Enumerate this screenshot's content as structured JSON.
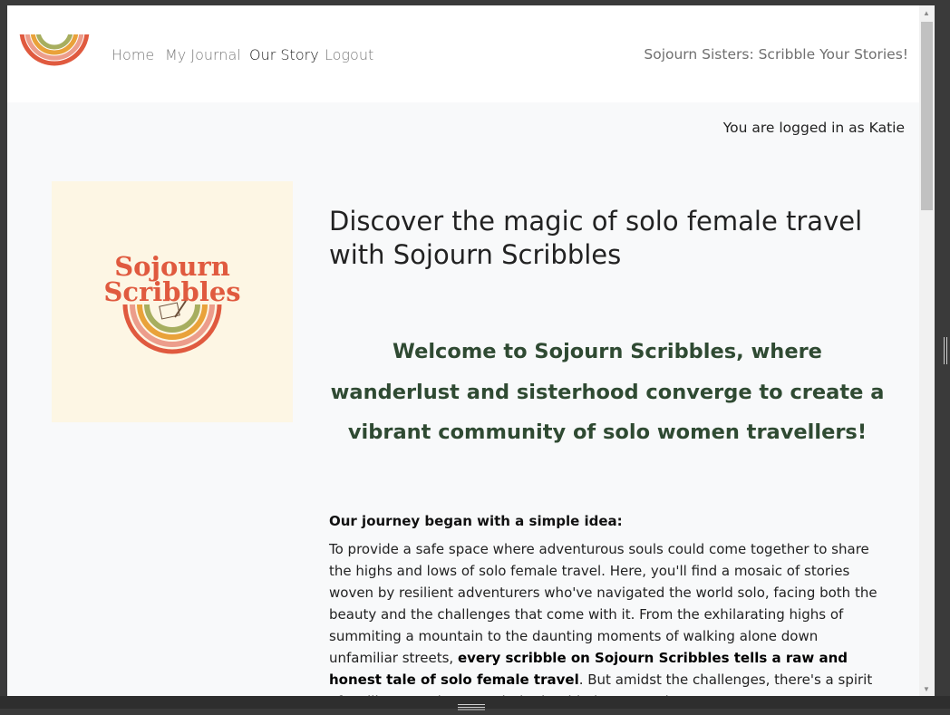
{
  "nav": {
    "links": [
      {
        "label": "Home",
        "active": false
      },
      {
        "label": "My Journal",
        "active": false
      },
      {
        "label": "Our Story",
        "active": true
      },
      {
        "label": "Logout",
        "active": false
      }
    ],
    "brand": "Sojourn Sisters: Scribble Your Stories!",
    "logo_icon": "rainbow-logo-icon"
  },
  "user": {
    "logged_in_text": "You are logged in as Katie"
  },
  "hero": {
    "image_line1": "Sojourn",
    "image_line2": "Scribbles",
    "title": "Discover the magic of solo female travel with Sojourn Scribbles"
  },
  "welcome": "Welcome to Sojourn Scribbles, where wanderlust and sisterhood converge to create a vibrant community of solo women travellers!",
  "story": {
    "heading": "Our journey began with a simple idea:",
    "body_start": "To provide a safe space where adventurous souls could come together to share the highs and lows of solo female travel. Here, you'll find a mosaic of stories woven by resilient adventurers who've navigated the world solo, facing both the beauty and the challenges that come with it. From the exhilarating highs of summiting a mountain to the daunting moments of walking alone down unfamiliar streets, ",
    "body_bold": "every scribble on Sojourn Scribbles tells a raw and honest tale of solo female travel",
    "body_end": ". But amidst the challenges, there's a spirit of resilience and camaraderie that binds us together – a"
  },
  "colors": {
    "brand_red": "#e05a3f",
    "rainbow_pink": "#ec9d8b",
    "rainbow_orange": "#e9a23a",
    "rainbow_green": "#a7ae5f",
    "welcome_green": "#2f4a32",
    "hero_bg": "#fdf6e4"
  }
}
